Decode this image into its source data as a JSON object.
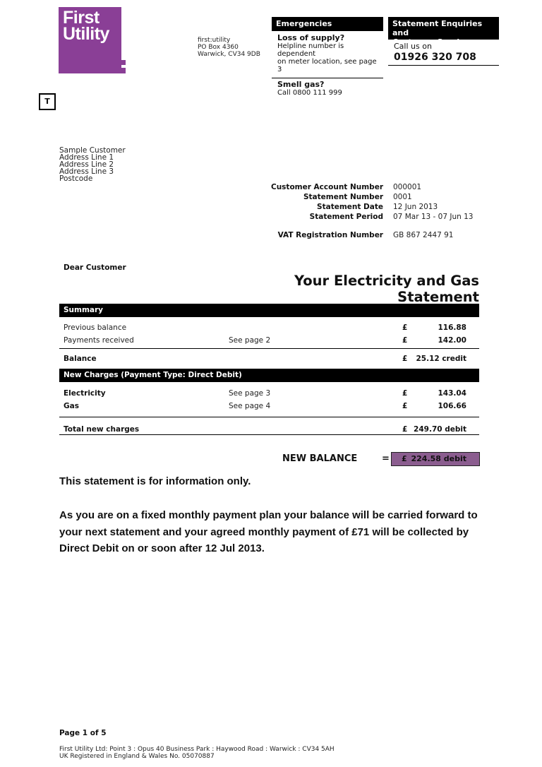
{
  "logo": {
    "line1": "First",
    "line2": "Utility",
    "color": "#8a3f96"
  },
  "return_address": [
    "first:utility",
    "PO Box 4360",
    "Warwick, CV34 9DB"
  ],
  "emergencies": {
    "title": "Emergencies",
    "loss_of_supply": {
      "heading": "Loss of supply?",
      "text_line1": "Helpline number is dependent",
      "text_line2": "on meter location, see page 3"
    },
    "smell_gas": {
      "heading": "Smell gas?",
      "text": "Call 0800 111 999"
    }
  },
  "enquiries": {
    "title_line1": "Statement Enquiries and",
    "title_line2": "Customer Service",
    "call_label": "Call us on",
    "phone": "01926 320 708"
  },
  "t_marker": "T",
  "customer_address": [
    "Sample Customer",
    "Address Line 1",
    "Address Line 2",
    "Address Line 3",
    "Postcode"
  ],
  "account_details": [
    {
      "label": "Customer Account Number",
      "value": "000001"
    },
    {
      "label": "Statement Number",
      "value": "0001"
    },
    {
      "label": "Statement Date",
      "value": "12 Jun 2013"
    },
    {
      "label": "Statement Period",
      "value": "07 Mar 13 - 07 Jun 13"
    }
  ],
  "vat": {
    "label": "VAT Registration Number",
    "value": "GB 867 2447 91"
  },
  "greeting": "Dear Customer",
  "title": "Your Electricity and Gas Statement",
  "summary": {
    "title": "Summary",
    "currency": "£",
    "rows": [
      {
        "label": "Previous balance",
        "ref": "",
        "amount": "116.88"
      },
      {
        "label": "Payments received",
        "ref": "See page 2",
        "amount": "142.00"
      }
    ],
    "balance": {
      "label": "Balance",
      "amount": "25.12 credit"
    }
  },
  "new_charges": {
    "title": "New Charges (Payment Type: Direct Debit)",
    "currency": "£",
    "rows": [
      {
        "label": "Electricity",
        "ref": "See page 3",
        "amount": "143.04"
      },
      {
        "label": "Gas",
        "ref": "See page 4",
        "amount": "106.66"
      }
    ],
    "total": {
      "label": "Total new charges",
      "amount": "249.70 debit"
    }
  },
  "new_balance": {
    "label": "NEW BALANCE",
    "equals": "=",
    "currency": "£",
    "amount": "224.58 debit",
    "color": "#8b5d8f"
  },
  "info_only": "This statement is for information only.",
  "plan_note": "As you are on a fixed monthly payment plan your balance will be carried forward to your next statement and your agreed monthly payment of £71 will be collected by Direct Debit on or soon after 12 Jul 2013.",
  "footer": {
    "page": "Page 1 of 5",
    "address_line1": "First Utility Ltd: Point 3 : Opus 40 Business Park : Haywood Road : Warwick : CV34 5AH",
    "address_line2": "UK Registered in England & Wales No. 05070887"
  }
}
